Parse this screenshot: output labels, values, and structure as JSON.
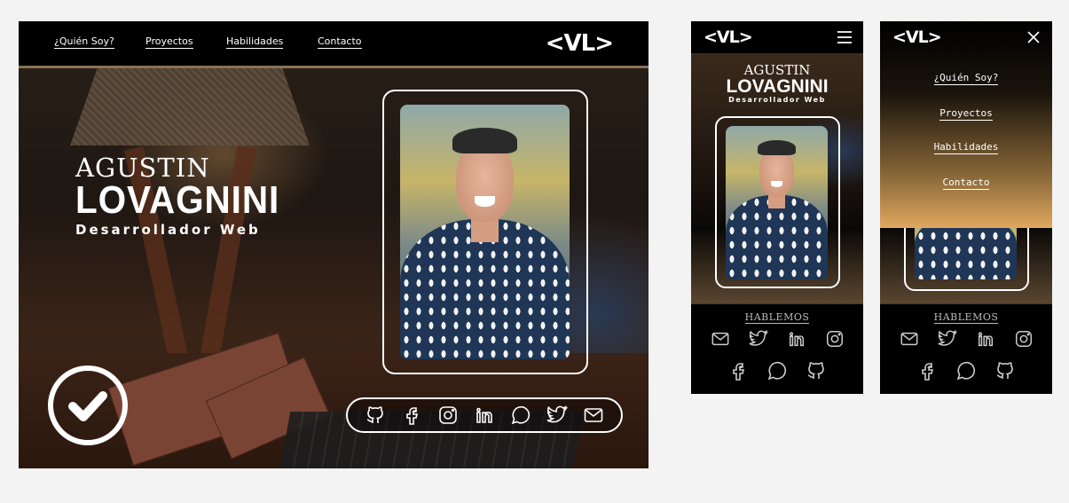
{
  "nav": {
    "items": [
      "¿Quién Soy?",
      "Proyectos",
      "Habilidades",
      "Contacto"
    ],
    "logo": "<VL>"
  },
  "hero": {
    "first_name": "AGUSTIN",
    "last_name": "LOVAGNINI",
    "role": "Desarrollador Web"
  },
  "contact": {
    "heading": "HABLEMOS"
  },
  "desktop_social_icons": [
    "github-icon",
    "facebook-icon",
    "instagram-icon",
    "linkedin-icon",
    "whatsapp-icon",
    "twitter-icon",
    "mail-icon"
  ],
  "mobile_social_row1": [
    "mail-icon",
    "twitter-icon",
    "linkedin-icon",
    "instagram-icon"
  ],
  "mobile_social_row2": [
    "facebook-icon",
    "whatsapp-icon",
    "github-icon"
  ],
  "colors": {
    "accent_gold": "#e0a860",
    "nav_border": "#8a7256",
    "background": "#f3f3f3"
  }
}
